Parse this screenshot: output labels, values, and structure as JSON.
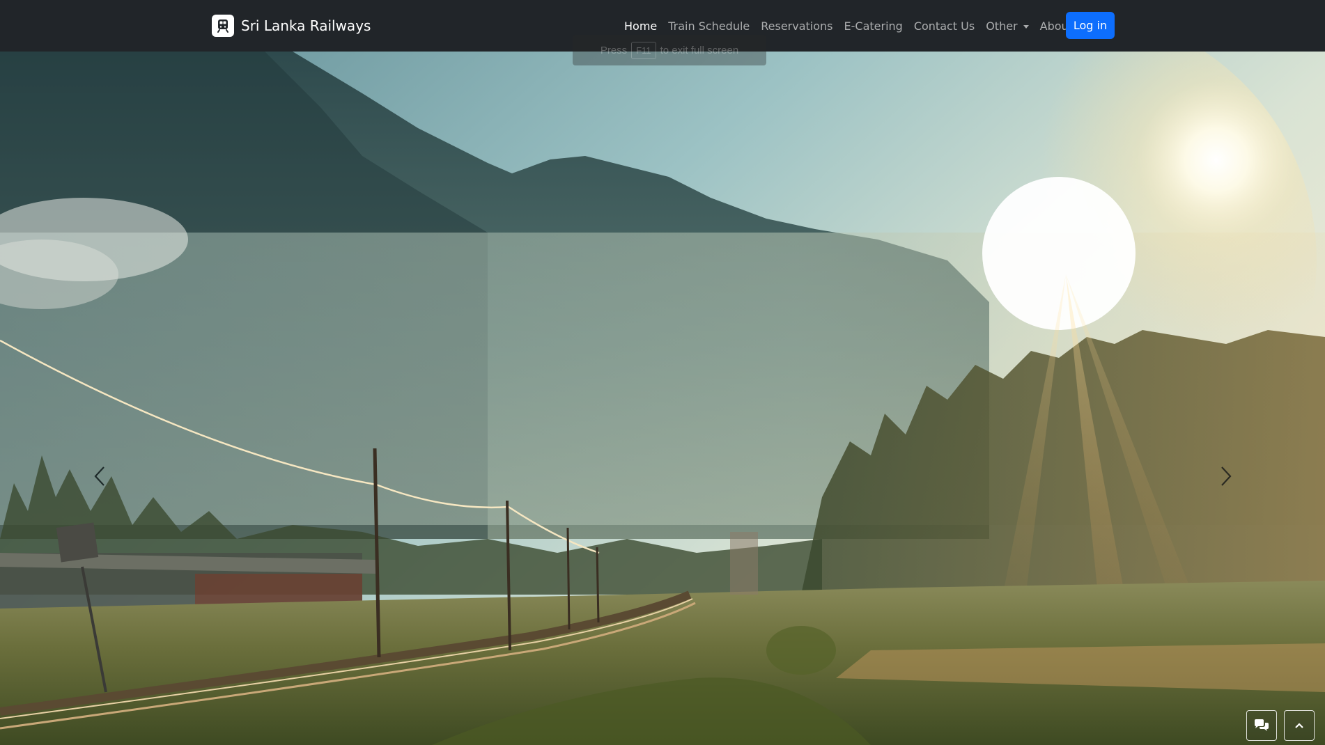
{
  "brand": {
    "name": "Sri Lanka Railways",
    "logo_icon": "train-icon"
  },
  "nav": {
    "items": [
      {
        "label": "Home",
        "active": true
      },
      {
        "label": "Train Schedule",
        "active": false
      },
      {
        "label": "Reservations",
        "active": false
      },
      {
        "label": "E-Catering",
        "active": false
      },
      {
        "label": "Contact Us",
        "active": false
      },
      {
        "label": "Other",
        "active": false,
        "dropdown": true
      },
      {
        "label": "About Us",
        "active": false,
        "dropdown": true
      }
    ],
    "login_label": "Log in"
  },
  "fullscreen_toast": {
    "prefix": "Press",
    "key": "F11",
    "suffix": "to exit full screen"
  },
  "carousel": {
    "prev_icon": "chevron-left-icon",
    "next_icon": "chevron-right-icon"
  },
  "floating": {
    "chat_icon": "chat-bubbles-icon",
    "top_icon": "chevron-up-icon"
  },
  "colors": {
    "navbar_bg": "#212529",
    "accent": "#0d6efd",
    "text": "#ffffff"
  }
}
